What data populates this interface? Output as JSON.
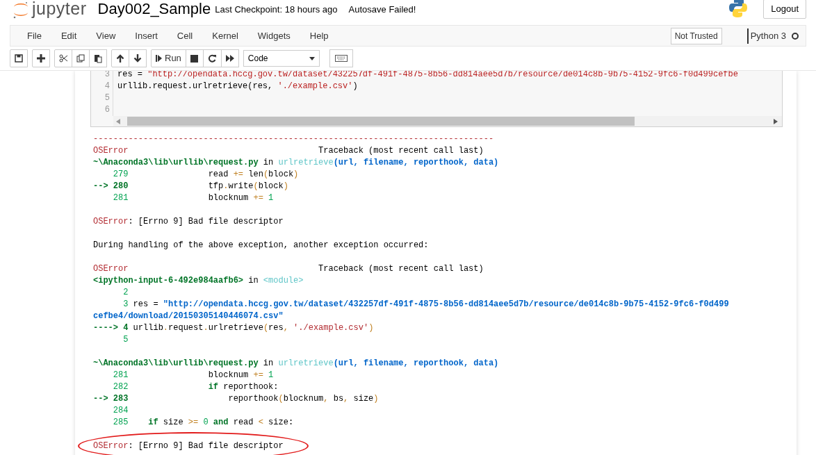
{
  "header": {
    "logo_text": "jupyter",
    "notebook_name": "Day002_Sample",
    "checkpoint": "Last Checkpoint: 18 hours ago",
    "autosave": "Autosave Failed!",
    "logout": "Logout"
  },
  "menu": [
    "File",
    "Edit",
    "View",
    "Insert",
    "Cell",
    "Kernel",
    "Widgets",
    "Help"
  ],
  "trust": "Not Trusted",
  "kernel": {
    "name": "Python 3",
    "busy": false
  },
  "toolbar": {
    "groups": [
      [
        {
          "kind": "save"
        }
      ],
      [
        {
          "kind": "plus"
        }
      ],
      [
        {
          "kind": "cut"
        },
        {
          "kind": "copy"
        },
        {
          "kind": "paste"
        }
      ],
      [
        {
          "kind": "up"
        },
        {
          "kind": "down"
        }
      ],
      [
        {
          "kind": "run",
          "label": "Run"
        },
        {
          "kind": "stop"
        },
        {
          "kind": "restart"
        },
        {
          "kind": "forward"
        }
      ]
    ],
    "cell_type": "Code"
  },
  "code_cell": {
    "lines": [
      {
        "number": "3",
        "segments": [
          {
            "text": "res = ",
            "kind": "plain"
          },
          {
            "text": "\"http://opendata.hccg.gov.tw/dataset/432257df-491f-4875-8b56-dd814aee5d7b/resource/de014c8b-9b75-4152-9fc6-f0d499cefbe",
            "kind": "cstring"
          }
        ]
      },
      {
        "number": "4",
        "segments": [
          {
            "text": "urllib.request.urlretrieve(res, ",
            "kind": "plain"
          },
          {
            "text": "'./example.csv'",
            "kind": "cstring"
          },
          {
            "text": ")",
            "kind": "plain"
          }
        ]
      },
      {
        "number": "5"
      },
      {
        "number": "6"
      }
    ]
  },
  "output": {
    "blocks": [
      [
        {
          "circled": false,
          "segments": [
            {
              "text": "--------------------------------------------------------------------------------",
              "kind": "error"
            }
          ]
        },
        {
          "circled": false,
          "segments": [
            {
              "text": "OSError",
              "kind": "error"
            },
            {
              "text": "                                      Traceback (most recent call last)",
              "kind": "plain"
            }
          ]
        },
        {
          "circled": false,
          "segments": [
            {
              "text": "~\\Anaconda3\\lib\\urllib\\request.py",
              "kind": "path"
            },
            {
              "text": " in ",
              "kind": "plain"
            },
            {
              "text": "urlretrieve",
              "kind": "func"
            },
            {
              "text": "(url, filename, reporthook, data)",
              "kind": "args"
            }
          ]
        },
        {
          "circled": false,
          "segments": [
            {
              "text": "    279",
              "kind": "lineno"
            },
            {
              "text": "                read ",
              "kind": "plain"
            },
            {
              "text": "+=",
              "kind": "op"
            },
            {
              "text": " len",
              "kind": "plain"
            },
            {
              "text": "(",
              "kind": "op"
            },
            {
              "text": "block",
              "kind": "plain"
            },
            {
              "text": ")",
              "kind": "op"
            }
          ]
        },
        {
          "circled": false,
          "segments": [
            {
              "text": "--> 280",
              "kind": "arrow"
            },
            {
              "text": "                tfp",
              "kind": "plain"
            },
            {
              "text": ".",
              "kind": "op"
            },
            {
              "text": "write",
              "kind": "plain"
            },
            {
              "text": "(",
              "kind": "op"
            },
            {
              "text": "block",
              "kind": "plain"
            },
            {
              "text": ")",
              "kind": "op"
            }
          ]
        },
        {
          "circled": false,
          "segments": [
            {
              "text": "    281",
              "kind": "lineno"
            },
            {
              "text": "                blocknum ",
              "kind": "plain"
            },
            {
              "text": "+=",
              "kind": "op"
            },
            {
              "text": " 1",
              "kind": "num"
            }
          ]
        }
      ],
      [
        {
          "circled": false,
          "segments": [
            {
              "text": "OSError",
              "kind": "error"
            },
            {
              "text": ": [Errno 9] Bad file descriptor",
              "kind": "plain"
            }
          ]
        }
      ],
      [
        {
          "circled": false,
          "segments": [
            {
              "text": "During handling of the above exception, another exception occurred:",
              "kind": "plain"
            }
          ]
        }
      ],
      [
        {
          "circled": false,
          "segments": [
            {
              "text": "OSError",
              "kind": "error"
            },
            {
              "text": "                                      Traceback (most recent call last)",
              "kind": "plain"
            }
          ]
        },
        {
          "circled": false,
          "segments": [
            {
              "text": "<ipython-input-6-492e984aafb6>",
              "kind": "path"
            },
            {
              "text": " in ",
              "kind": "plain"
            },
            {
              "text": "<module>",
              "kind": "func"
            }
          ]
        },
        {
          "circled": false,
          "segments": [
            {
              "text": "      2",
              "kind": "lineno"
            }
          ]
        },
        {
          "circled": false,
          "segments": [
            {
              "text": "      3",
              "kind": "lineno"
            },
            {
              "text": " res = ",
              "kind": "plain"
            },
            {
              "text": "\"http://opendata.hccg.gov.tw/dataset/432257df-491f-4875-8b56-dd814aee5d7b/resource/de014c8b-9b75-4152-9fc6-f0d499",
              "kind": "string"
            }
          ]
        },
        {
          "circled": false,
          "segments": [
            {
              "text": "cefbe4/download/20150305140446074.csv\"",
              "kind": "string"
            }
          ]
        },
        {
          "circled": false,
          "segments": [
            {
              "text": "----> 4",
              "kind": "arrow"
            },
            {
              "text": " urllib",
              "kind": "plain"
            },
            {
              "text": ".",
              "kind": "op"
            },
            {
              "text": "request",
              "kind": "plain"
            },
            {
              "text": ".",
              "kind": "op"
            },
            {
              "text": "urlretrieve",
              "kind": "plain"
            },
            {
              "text": "(",
              "kind": "op"
            },
            {
              "text": "res",
              "kind": "plain"
            },
            {
              "text": ",",
              "kind": "op"
            },
            {
              "text": " './example.csv'",
              "kind": "pstring"
            },
            {
              "text": ")",
              "kind": "op"
            }
          ]
        },
        {
          "circled": false,
          "segments": [
            {
              "text": "      5",
              "kind": "lineno"
            }
          ]
        }
      ],
      [
        {
          "circled": false,
          "segments": [
            {
              "text": "~\\Anaconda3\\lib\\urllib\\request.py",
              "kind": "path"
            },
            {
              "text": " in ",
              "kind": "plain"
            },
            {
              "text": "urlretrieve",
              "kind": "func"
            },
            {
              "text": "(url, filename, reporthook, data)",
              "kind": "args"
            }
          ]
        },
        {
          "circled": false,
          "segments": [
            {
              "text": "    281",
              "kind": "lineno"
            },
            {
              "text": "                blocknum ",
              "kind": "plain"
            },
            {
              "text": "+=",
              "kind": "op"
            },
            {
              "text": " 1",
              "kind": "num"
            }
          ]
        },
        {
          "circled": false,
          "segments": [
            {
              "text": "    282",
              "kind": "lineno"
            },
            {
              "text": "                if",
              "kind": "keyword"
            },
            {
              "text": " reporthook:",
              "kind": "plain"
            }
          ]
        },
        {
          "circled": false,
          "segments": [
            {
              "text": "--> 283",
              "kind": "arrow"
            },
            {
              "text": "                    reporthook",
              "kind": "plain"
            },
            {
              "text": "(",
              "kind": "op"
            },
            {
              "text": "blocknum",
              "kind": "plain"
            },
            {
              "text": ",",
              "kind": "op"
            },
            {
              "text": " bs",
              "kind": "plain"
            },
            {
              "text": ",",
              "kind": "op"
            },
            {
              "text": " size",
              "kind": "plain"
            },
            {
              "text": ")",
              "kind": "op"
            }
          ]
        },
        {
          "circled": false,
          "segments": [
            {
              "text": "    284",
              "kind": "lineno"
            }
          ]
        },
        {
          "circled": false,
          "segments": [
            {
              "text": "    285",
              "kind": "lineno"
            },
            {
              "text": "    if",
              "kind": "keyword"
            },
            {
              "text": " size ",
              "kind": "plain"
            },
            {
              "text": ">=",
              "kind": "op"
            },
            {
              "text": " 0",
              "kind": "num"
            },
            {
              "text": " and",
              "kind": "keyword"
            },
            {
              "text": " read ",
              "kind": "plain"
            },
            {
              "text": "<",
              "kind": "op"
            },
            {
              "text": " size:",
              "kind": "plain"
            }
          ]
        }
      ],
      [
        {
          "circled": true,
          "segments": [
            {
              "text": "OSError",
              "kind": "error"
            },
            {
              "text": ": [Errno 9] Bad file descriptor",
              "kind": "plain"
            }
          ]
        }
      ]
    ]
  }
}
